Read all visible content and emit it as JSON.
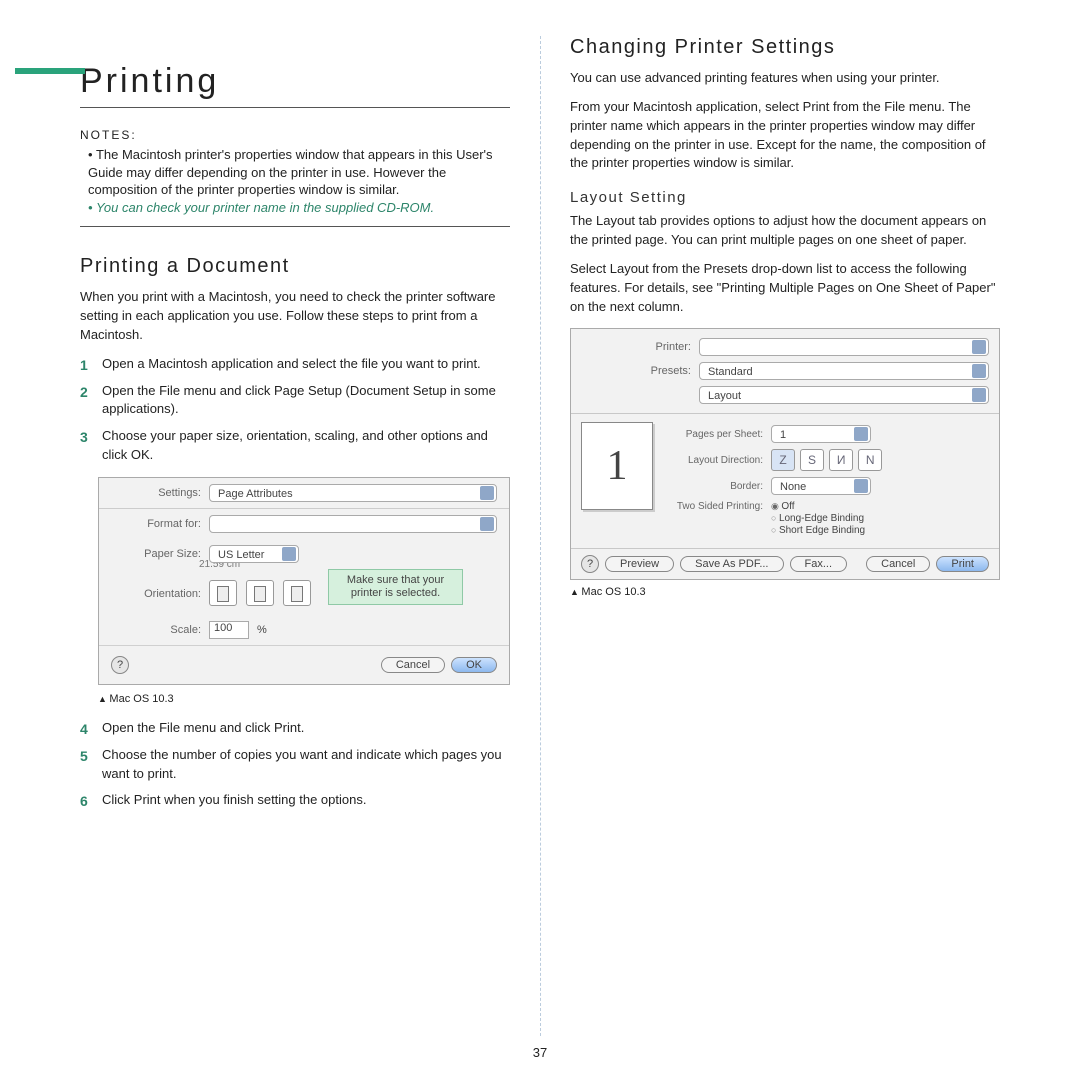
{
  "left": {
    "heading": "Printing",
    "notes_label": "NOTES:",
    "notes": [
      "The Macintosh printer's properties window that appears in this User's Guide may differ depending on the printer in use. However the composition of the printer properties window is similar.",
      "You can check your printer name in the supplied CD-ROM."
    ],
    "subheading": "Printing a Document",
    "intro": "When you print with a Macintosh, you need to check the printer software setting in each application you use. Follow these steps to print from a Macintosh.",
    "steps_a": [
      "Open a Macintosh application and select the file you want to print.",
      "Open the File menu and click Page Setup (Document Setup in some applications).",
      "Choose your paper size, orientation, scaling, and other options and click OK."
    ],
    "steps_b": [
      "Open the File menu and click Print.",
      "Choose the number of copies you want and indicate which pages you want to print.",
      "Click Print when you finish setting the options."
    ],
    "dialog": {
      "settings_label": "Settings:",
      "settings_value": "Page Attributes",
      "format_label": "Format for:",
      "format_value": "",
      "paper_label": "Paper Size:",
      "paper_value": "US Letter",
      "paper_sub": "21.59 cm",
      "callout": "Make sure that your printer is selected.",
      "orient_label": "Orientation:",
      "scale_label": "Scale:",
      "scale_value": "100",
      "scale_unit": "%",
      "cancel": "Cancel",
      "ok": "OK"
    },
    "caption": "Mac OS 10.3"
  },
  "right": {
    "heading": "Changing Printer Settings",
    "p1": "You can use advanced printing features when using your printer.",
    "p2": "From your Macintosh application, select Print from the File menu. The printer name which appears in the printer properties window may differ depending on the printer in use. Except for the name, the composition of the printer properties window is similar.",
    "layout_heading": "Layout Setting",
    "layout_p1": "The Layout tab provides options to adjust how the document appears on the printed page. You can print multiple pages on one sheet of paper.",
    "layout_p2": "Select Layout from the Presets drop-down list to access the following features. For details, see \"Printing Multiple Pages on One Sheet of Paper\" on the next column.",
    "dialog": {
      "printer_label": "Printer:",
      "printer_value": "",
      "presets_label": "Presets:",
      "presets_value": "Standard",
      "panel_value": "Layout",
      "pps_label": "Pages per Sheet:",
      "pps_value": "1",
      "dir_label": "Layout Direction:",
      "border_label": "Border:",
      "border_value": "None",
      "tsp_label": "Two Sided Printing:",
      "tsp_off": "Off",
      "tsp_long": "Long-Edge Binding",
      "tsp_short": "Short Edge Binding",
      "preview": "Preview",
      "saveas": "Save As PDF...",
      "fax": "Fax...",
      "cancel": "Cancel",
      "print": "Print"
    },
    "caption": "Mac OS 10.3"
  },
  "page_number": "37"
}
